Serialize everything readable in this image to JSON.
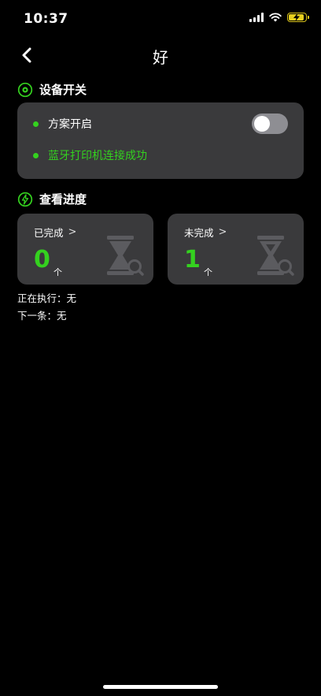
{
  "status_bar": {
    "time": "10:37"
  },
  "nav": {
    "title": "好"
  },
  "device_section": {
    "title": "设备开关",
    "scheme_label": "方案开启",
    "scheme_enabled": false,
    "bluetooth_status": "蓝牙打印机连接成功"
  },
  "progress_section": {
    "title": "查看进度",
    "completed": {
      "label": "已完成",
      "count": "0",
      "unit": "个"
    },
    "uncompleted": {
      "label": "未完成",
      "count": "1",
      "unit": "个"
    }
  },
  "execution": {
    "current": "正在执行：无",
    "next": "下一条：无"
  },
  "colors": {
    "accent_green": "#34d11f",
    "card_bg": "#3a3a3c"
  }
}
